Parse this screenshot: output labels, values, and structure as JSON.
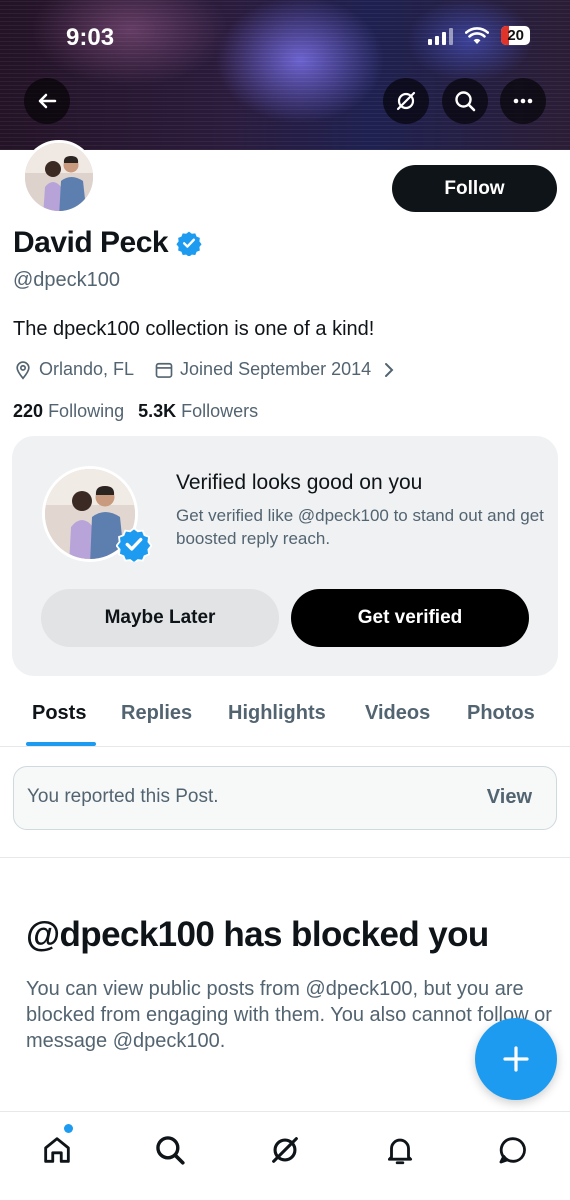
{
  "status_bar": {
    "time": "9:03",
    "battery": "20"
  },
  "header_icons": [
    "back-arrow-icon",
    "grok-icon",
    "search-icon",
    "more-icon"
  ],
  "profile": {
    "follow_label": "Follow",
    "name": "David Peck",
    "handle": "@dpeck100",
    "bio": "The dpeck100 collection is one of a kind!",
    "location": "Orlando, FL",
    "joined": "Joined September 2014",
    "following_count": "220",
    "following_label": "Following",
    "followers_count": "5.3K",
    "followers_label": "Followers"
  },
  "verified_card": {
    "title": "Verified looks good on you",
    "description": "Get verified like @dpeck100 to stand out and get boosted reply reach.",
    "maybe_label": "Maybe Later",
    "verify_label": "Get verified"
  },
  "tabs": [
    {
      "label": "Posts"
    },
    {
      "label": "Replies"
    },
    {
      "label": "Highlights"
    },
    {
      "label": "Videos"
    },
    {
      "label": "Photos"
    }
  ],
  "notice": {
    "text": "You reported this Post.",
    "action": "View"
  },
  "blocked": {
    "title": "@dpeck100 has blocked you",
    "description": "You can view public posts from @dpeck100, but you are blocked from engaging with them. You also cannot follow or message @dpeck100."
  },
  "bottom_nav": [
    "home-icon",
    "search-icon",
    "grok-icon",
    "notifications-icon",
    "messages-icon"
  ],
  "colors": {
    "accent": "#1d9bf0",
    "text_primary": "#0f1419",
    "text_secondary": "#536471"
  }
}
